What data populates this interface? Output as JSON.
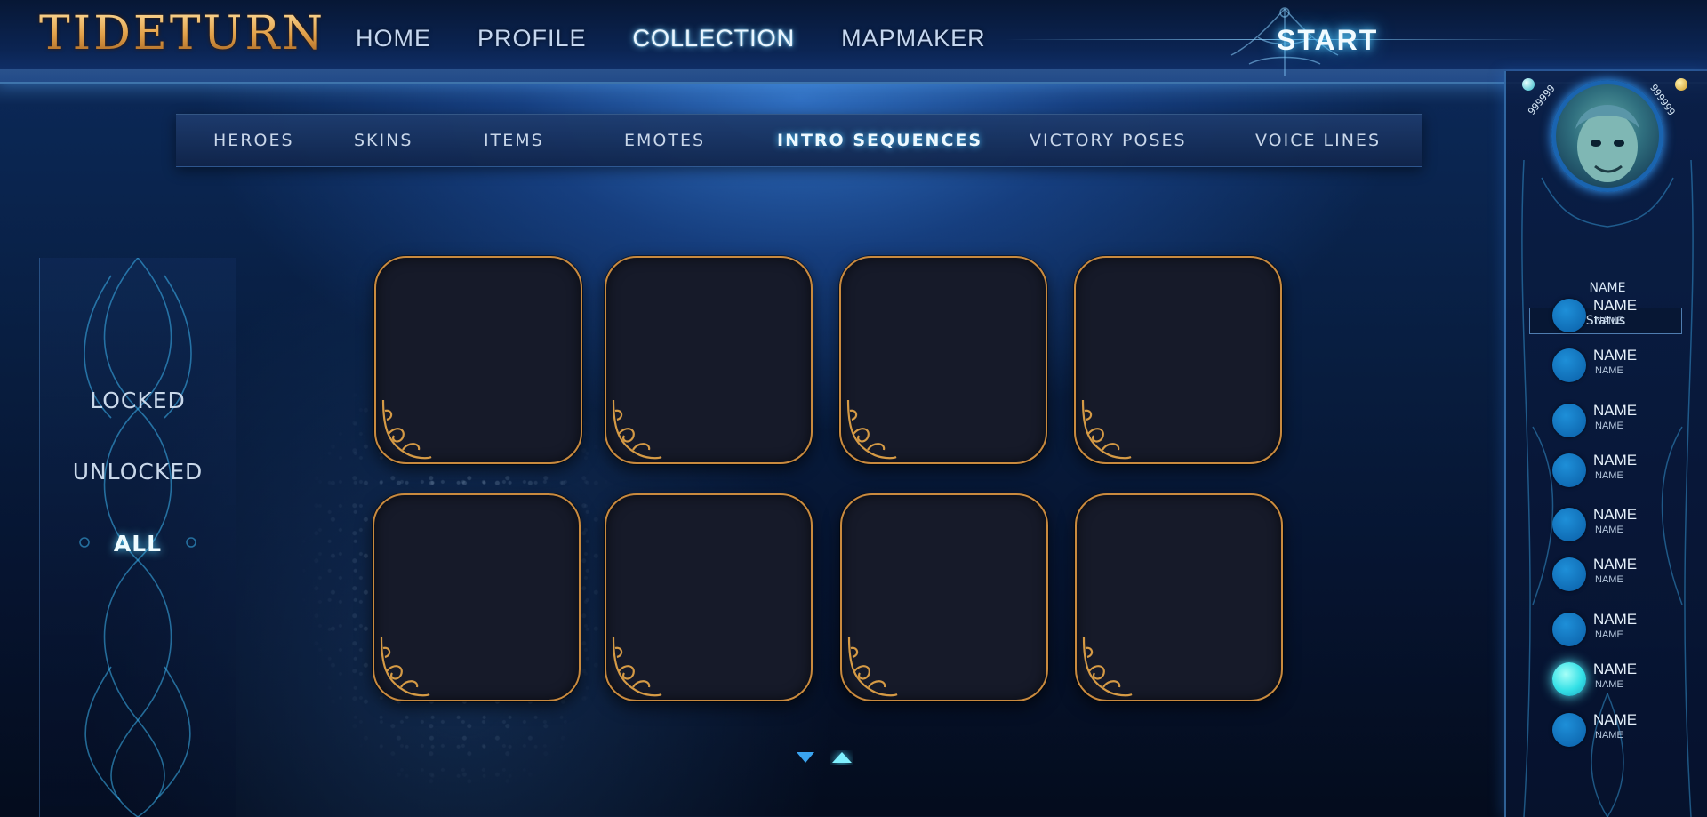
{
  "app": {
    "logo": "TIDETURN"
  },
  "main_nav": {
    "items": [
      {
        "label": "HOME",
        "active": false
      },
      {
        "label": "PROFILE",
        "active": false
      },
      {
        "label": "COLLECTION",
        "active": true
      },
      {
        "label": "MAPMAKER",
        "active": false
      }
    ],
    "start_label": "START"
  },
  "sub_nav": {
    "tabs": [
      {
        "label": "HEROES",
        "active": false
      },
      {
        "label": "SKINS",
        "active": false
      },
      {
        "label": "ITEMS",
        "active": false
      },
      {
        "label": "EMOTES",
        "active": false
      },
      {
        "label": "INTRO SEQUENCES",
        "active": true
      },
      {
        "label": "VICTORY POSES",
        "active": false
      },
      {
        "label": "VOICE LINES",
        "active": false
      }
    ]
  },
  "filters": {
    "items": [
      {
        "label": "LOCKED",
        "active": false
      },
      {
        "label": "UNLOCKED",
        "active": false
      },
      {
        "label": "ALL",
        "active": true
      }
    ]
  },
  "grid": {
    "card_count": 8,
    "rows": 2,
    "columns": 4
  },
  "pager": {
    "prev_icon": "triangle-down-icon",
    "next_icon": "triangle-up-icon"
  },
  "profile": {
    "currency_left": "999999",
    "currency_right": "999999",
    "name": "NAME",
    "status": "Status"
  },
  "friends": [
    {
      "name": "NAME",
      "sub": "NAME",
      "online": false
    },
    {
      "name": "NAME",
      "sub": "NAME",
      "online": false
    },
    {
      "name": "NAME",
      "sub": "NAME",
      "online": false
    },
    {
      "name": "NAME",
      "sub": "NAME",
      "online": false
    },
    {
      "name": "NAME",
      "sub": "NAME",
      "online": false
    },
    {
      "name": "NAME",
      "sub": "NAME",
      "online": false
    },
    {
      "name": "NAME",
      "sub": "NAME",
      "online": false
    },
    {
      "name": "NAME",
      "sub": "NAME",
      "online": true
    },
    {
      "name": "NAME",
      "sub": "NAME",
      "online": false
    }
  ],
  "colors": {
    "accent_glow": "#5fd6ff",
    "card_border": "#c98a3e",
    "card_fill": "#161a29",
    "friend_dot": "#0f78c7",
    "friend_online": "#4ef0f2",
    "logo_gold": "#e3a24a"
  }
}
